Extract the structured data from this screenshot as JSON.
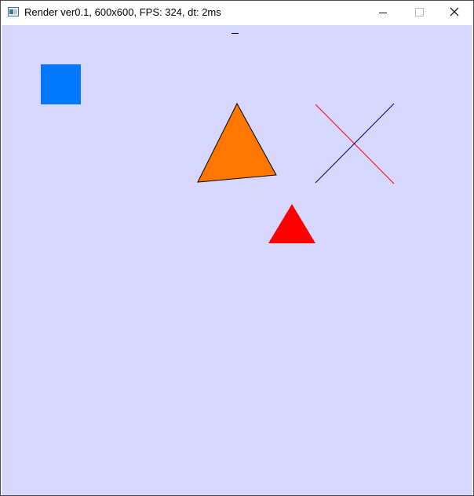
{
  "window": {
    "title": "Render ver0.1, 600x600, FPS: 324, dt: 2ms",
    "controls": {
      "minimize_icon": "minimize-icon",
      "maximize_icon": "maximize-icon",
      "close_icon": "close-icon"
    }
  },
  "canvas": {
    "background": "#d7d7ff",
    "shapes": [
      {
        "name": "blue-square",
        "kind": "square",
        "fill": "#0077ff"
      },
      {
        "name": "orange-triangle",
        "kind": "triangle",
        "fill": "#ff7700",
        "stroke": "#000000"
      },
      {
        "name": "red-triangle",
        "kind": "triangle",
        "fill": "#ff0000"
      },
      {
        "name": "red-line",
        "kind": "line",
        "stroke": "#ff0000"
      },
      {
        "name": "navy-line",
        "kind": "line",
        "stroke": "#000080"
      },
      {
        "name": "dash-mark",
        "kind": "line",
        "stroke": "#000000"
      }
    ]
  }
}
